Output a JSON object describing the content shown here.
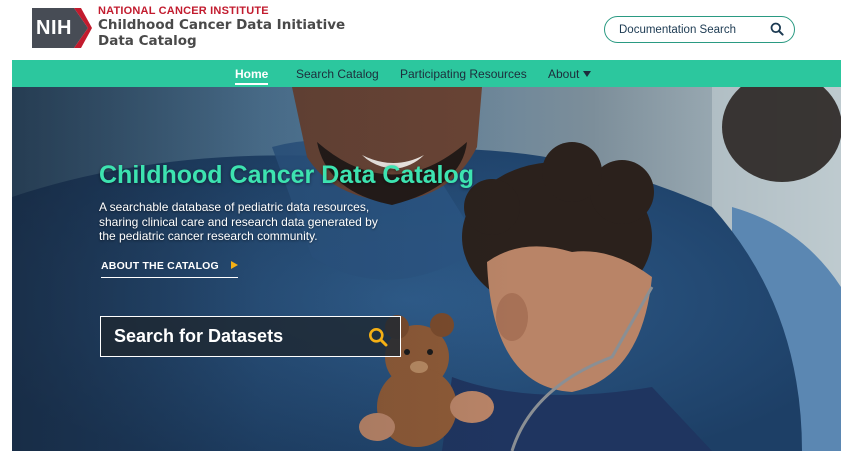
{
  "header": {
    "logo_badge": "NIH",
    "institute": "NATIONAL CANCER INSTITUTE",
    "initiative_line1": "Childhood Cancer Data Initiative",
    "initiative_line2": "Data Catalog",
    "doc_search_placeholder": "Documentation Search",
    "doc_search_icon": "search-icon"
  },
  "nav": {
    "items": [
      {
        "label": "Home",
        "active": true
      },
      {
        "label": "Search Catalog",
        "active": false
      },
      {
        "label": "Participating Resources",
        "active": false
      },
      {
        "label": "About",
        "active": false,
        "has_dropdown": true
      }
    ]
  },
  "hero": {
    "title": "Childhood Cancer Data Catalog",
    "description": "A searchable database of pediatric data resources, sharing clinical care and research data generated by the pediatric cancer research community.",
    "about_link": "ABOUT THE CATALOG",
    "dataset_search_label": "Search for Datasets",
    "dataset_search_icon": "search-icon"
  },
  "colors": {
    "nav_bg": "#2cc79e",
    "title_green": "#3de3b0",
    "nci_red": "#c21b2e",
    "nih_badge": "#474c55",
    "search_border": "#2a9a82",
    "arrow_orange": "#f5b014",
    "search_icon_yellow": "#f5b014"
  }
}
